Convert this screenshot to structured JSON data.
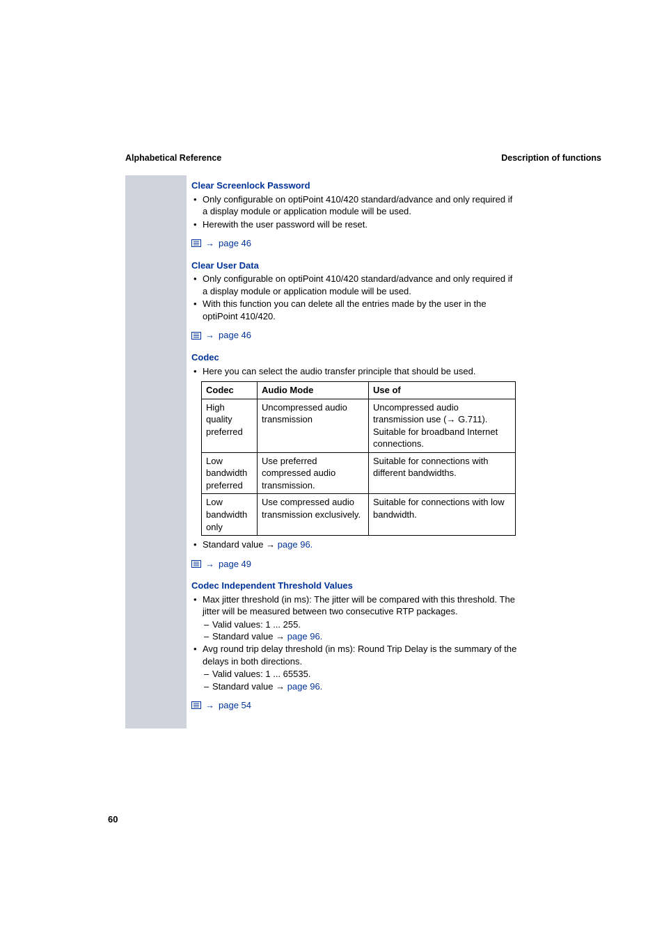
{
  "header": {
    "left": "Alphabetical Reference",
    "right": "Description of functions"
  },
  "pageNumber": "60",
  "sec1": {
    "title": "Clear Screenlock Password",
    "b1": "Only configurable on optiPoint 410/420 standard/advance and only required if a display module or application module will be used.",
    "b2": "Herewith the user password will be reset.",
    "ref": "page 46"
  },
  "sec2": {
    "title": "Clear User Data",
    "b1": "Only configurable on optiPoint 410/420 standard/advance and only required if a display module or application module will be used.",
    "b2": "With this function you can delete all the entries made by the user in the optiPoint 410/420.",
    "ref": "page 46"
  },
  "sec3": {
    "title": "Codec",
    "b1": "Here you can select the audio transfer principle that should be used.",
    "table": {
      "h1": "Codec",
      "h2": "Audio Mode",
      "h3": "Use of",
      "r1c1": "High quality preferred",
      "r1c2": "Uncompressed audio transmission",
      "r1c3a": "Uncompressed audio transmission use (",
      "r1c3b": " G.711). Suitable for broadband Internet connections.",
      "r2c1": "Low bandwidth preferred",
      "r2c2": "Use preferred compressed audio transmission.",
      "r2c3": "Suitable for connections with different bandwidths.",
      "r3c1": "Low bandwidth only",
      "r3c2": "Use compressed audio transmission exclusively.",
      "r3c3": "Suitable for connections with low bandwidth."
    },
    "std_a": "Standard value ",
    "std_b": " page 96.",
    "ref": "page 49"
  },
  "sec4": {
    "title": "Codec Independent Threshold Values",
    "b1": "Max jitter threshold (in ms): The jitter will be compared with this threshold. The jitter will be measured between two consecutive RTP packages.",
    "s1": "Valid values: 1 ... 255.",
    "s2a": "Standard value ",
    "s2b": " page 96.",
    "b2": "Avg round trip delay threshold (in ms): Round Trip Delay is the summary of the delays in both directions.",
    "s3": "Valid values: 1 ... 65535.",
    "s4a": "Standard value ",
    "s4b": " page 96.",
    "ref": "page 54"
  },
  "arrow": "→"
}
